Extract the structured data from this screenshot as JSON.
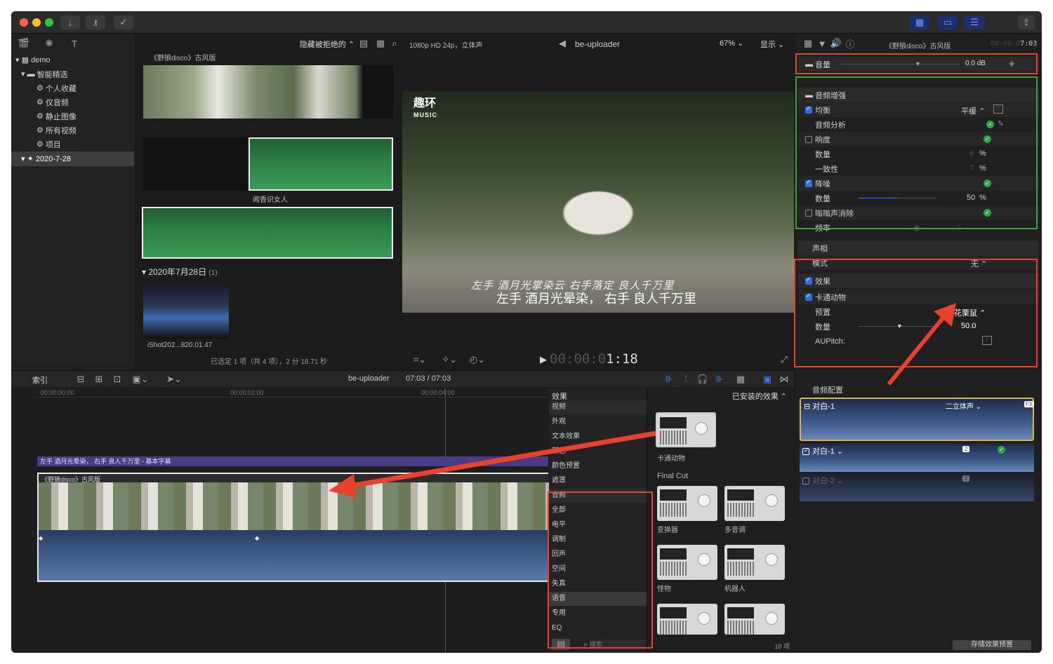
{
  "toolbar": {
    "buttons": [
      "download-icon",
      "key-icon",
      "check-circle-icon"
    ]
  },
  "library": {
    "root": "demo",
    "group": "智能精选",
    "items": [
      "个人收藏",
      "仅音频",
      "静止图像",
      "所有视频",
      "项目"
    ],
    "event": "2020-7-28"
  },
  "browser": {
    "filter": "隐藏被拒绝的",
    "clip1_title": "《野狼disco》古风版",
    "clip2_label": "闻香识女人",
    "date_header": "2020年7月28日",
    "date_count": "(1)",
    "clip3_label": "iShot202...820.01.47",
    "status": "已选定 1 项（共 4 项），2 分 18.71 秒"
  },
  "viewer": {
    "format": "1080p HD 24p，立体声",
    "title": "be-uploader",
    "zoom": "67%",
    "display": "显示",
    "logo_line1": "趣环",
    "logo_line2": "MUSIC",
    "subtitle_calligraphy": "左手 酒月光掌染云  右手落定 良人千万里",
    "subtitle": "左手 酒月光晕染，  右手 良人千万里",
    "timecode_dim": "00:00:0",
    "timecode_lit": "1:18"
  },
  "inspector": {
    "title": "《野狼disco》古风版",
    "timecode_dim": "00:00:0",
    "timecode_lit": "7:03",
    "volume_label": "音量",
    "volume_value": "0.0",
    "volume_unit": "dB",
    "enhance_header": "音频增强",
    "eq_label": "均衡",
    "eq_value": "平缓",
    "analysis_label": "音频分析",
    "loudness_label": "响度",
    "amount_label": "数量",
    "loud_amount": "6",
    "uniform_label": "一致性",
    "uniform_value": "7",
    "pct": "%",
    "nr_label": "降噪",
    "nr_amount": "50",
    "hum_label": "嗡嗡声消除",
    "freq_label": "频率",
    "pan_header": "声相",
    "mode_label": "模式",
    "mode_value": "无",
    "effects_label": "效果",
    "cartoon_label": "卡通动物",
    "preset_label": "预置",
    "preset_value": "花栗鼠",
    "effect_amount": "50.0",
    "aupitch_label": "AUPitch:",
    "audio_config_label": "音频配置",
    "track1": "对白-1",
    "track1_mode": "二立体声",
    "track1_badge": "FX",
    "track2": "对白-1",
    "track2_badge": "2",
    "track3": "对白-2",
    "track3_badge": "2",
    "save_preset": "存储效果预置"
  },
  "timeline": {
    "index_label": "索引",
    "project": "be-uploader",
    "duration": "07:03 / 07:03",
    "ticks": [
      "00:00:00:00",
      "00:00:02:00",
      "00:00:04:00"
    ],
    "title_clip": "左手 酒月光晕染，  右手 良人千万里 - 基本字幕",
    "video_clip": "《野狼disco》古风版"
  },
  "effects_browser": {
    "header": "效果",
    "installed": "已安装的效果",
    "categories": [
      "视频",
      "外观",
      "文本效果",
      "颜色",
      "颜色预置",
      "遮罩",
      "音频",
      "全部",
      "电平",
      "调制",
      "回声",
      "空间",
      "失真",
      "语音",
      "专用",
      "EQ"
    ],
    "selected": "语音",
    "section": "Final Cut",
    "tiles": [
      "卡通动物",
      "变换器",
      "多音调",
      "怪物",
      "机器人"
    ],
    "search_placeholder": "搜索",
    "count": "18 项"
  },
  "colors": {
    "accent": "#3a7bff",
    "annotation_red": "#e8412c",
    "annotation_green": "#3aa534",
    "clip_blue": "#3e5a8a",
    "audio_green": "#2c7d44",
    "title_purple": "#4b3a86"
  }
}
